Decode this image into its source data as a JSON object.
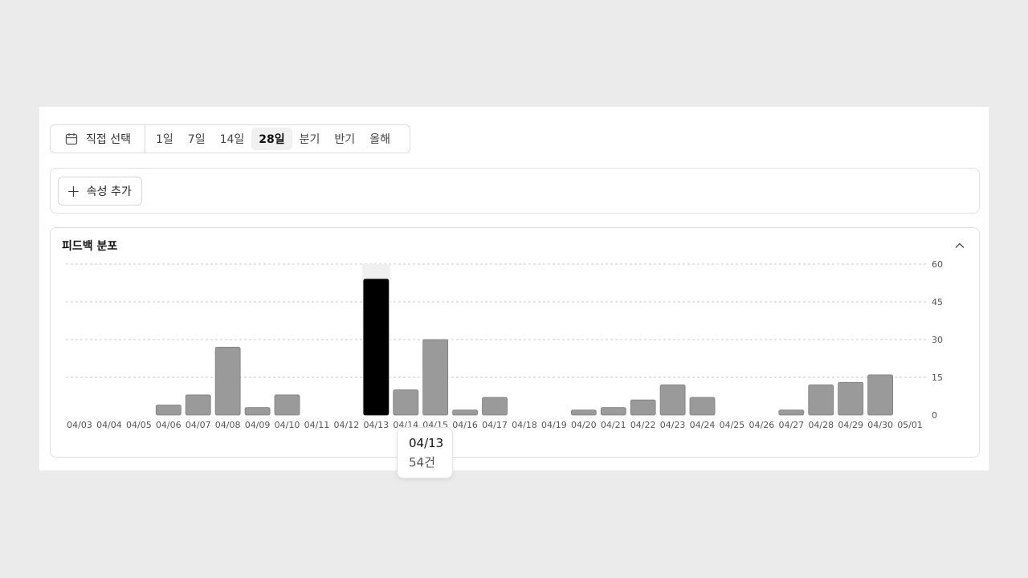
{
  "range_bar": {
    "custom_label": "직접 선택",
    "options": [
      "1일",
      "7일",
      "14일",
      "28일",
      "분기",
      "반기",
      "올해"
    ],
    "active": "28일"
  },
  "attributes": {
    "add_label": "속성 추가"
  },
  "chart": {
    "title": "피드백 분포"
  },
  "tooltip": {
    "date": "04/13",
    "value": "54건"
  },
  "chart_data": {
    "type": "bar",
    "title": "피드백 분포",
    "categories": [
      "04/03",
      "04/04",
      "04/05",
      "04/06",
      "04/07",
      "04/08",
      "04/09",
      "04/10",
      "04/11",
      "04/12",
      "04/13",
      "04/14",
      "04/15",
      "04/16",
      "04/17",
      "04/18",
      "04/19",
      "04/20",
      "04/21",
      "04/22",
      "04/23",
      "04/24",
      "04/25",
      "04/26",
      "04/27",
      "04/28",
      "04/29",
      "04/30",
      "05/01"
    ],
    "values": [
      0,
      0,
      0,
      4,
      8,
      27,
      3,
      8,
      0,
      0,
      54,
      10,
      30,
      2,
      7,
      0,
      0,
      2,
      3,
      6,
      12,
      7,
      0,
      0,
      2,
      12,
      13,
      16,
      0
    ],
    "ylim": [
      0,
      60
    ],
    "yticks": [
      0,
      15,
      30,
      45,
      60
    ],
    "grid": true,
    "highlight": "04/13",
    "colors": {
      "bar": "#9a9a9a",
      "bar_stroke": "#7d7d7d",
      "highlight": "#000000",
      "grid": "#c8c8c8"
    }
  }
}
